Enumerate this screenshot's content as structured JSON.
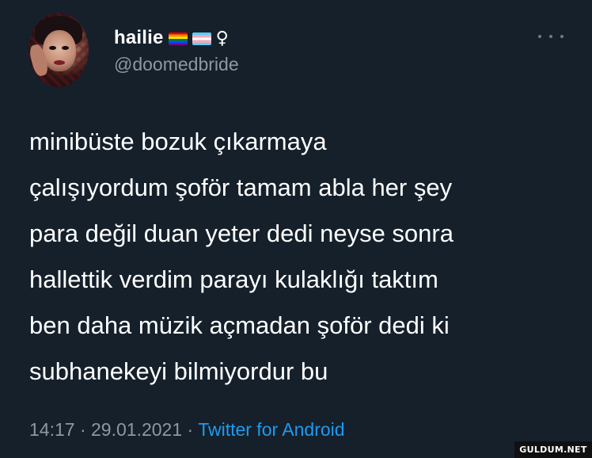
{
  "user": {
    "display_name": "hailie",
    "flags": [
      "rainbow-flag-icon",
      "transgender-flag-icon"
    ],
    "female_sign": "♀",
    "handle": "@doomedbride"
  },
  "menu": {
    "icon": "more-icon"
  },
  "tweet": {
    "text": "minibüste bozuk çıkarmaya\nçalışıyordum şoför tamam abla her şey\npara değil duan yeter dedi neyse sonra\nhallettik verdim parayı kulaklığı taktım\nben daha müzik açmadan şoför dedi ki\nsubhanekeyi bilmiyordur bu"
  },
  "meta": {
    "time": "14:17",
    "separator": "·",
    "date": "29.01.2021",
    "source": "Twitter for Android"
  },
  "watermark": "GULDUM.NET",
  "colors": {
    "background": "#15202b",
    "text": "#ffffff",
    "secondary": "#8b98a5",
    "link": "#1d9bf0"
  }
}
